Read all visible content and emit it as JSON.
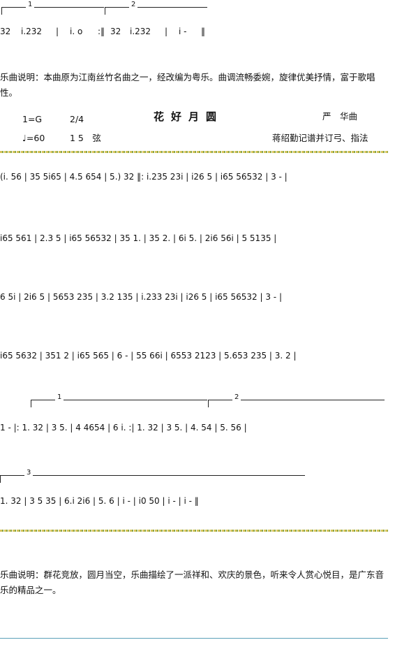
{
  "top_score": {
    "volta1": "1",
    "volta2": "2",
    "tokens": [
      "32",
      "i.232",
      "|",
      "i. o",
      ":‖",
      "32",
      "i.232",
      "|",
      "i -",
      "‖"
    ]
  },
  "intro_note": "乐曲说明：本曲原为江南丝竹名曲之一，经改编为粤乐。曲调流畅委婉，旋律优美抒情，富于歌唱性。",
  "header": {
    "key": "1=G",
    "meter": "2/4",
    "title": "花好月圆",
    "composer": "严　华曲",
    "tempo": "♩=60",
    "tuning": "1 5　弦",
    "credit": "蒋绍勤记谱并订弓、指法"
  },
  "score": {
    "line1": "(i.  56 | 35  5i65 | 4.5  654 | 5.)  32 ‖: i.235  23i | i26  5 | i65  56532 | 3 - |",
    "line2": "i65  561 | 2.3  5 | i65  56532 | 35  1. | 35  2. | 6i  5. | 2i6  56i | 5  5135 |",
    "line3": "6  5i | 2i6  5 | 5653  235 | 3.2  135 | i.233  23i | i26  5 | i65  56532 | 3 - |",
    "line4": "i65  5632 | 351  2 | i65  565 | 6 - | 55  66i | 6553  2123 | 5.653  235 | 3.  2 |",
    "line5": "1 - |: 1.  32 | 3  5. | 4  4654 | 6  i. :| 1.  32 | 3  5. | 4.  54 | 5.  56 |",
    "line6": "1.  32 | 3 5  35 | 6.i  2i6 | 5.  6 | i - | i0  50 | i - | i - ‖",
    "volta_line5_1": "1",
    "volta_line5_2": "2",
    "volta_line6_3": "3"
  },
  "ending_note": "乐曲说明：群花竞放，圆月当空，乐曲描绘了一派祥和、欢庆的景色，听来令人赏心悦目，是广东音乐的精品之一。",
  "colors": {
    "ornament_gold": "#d8c45a",
    "ornament_green": "#8aa648",
    "text": "#111111"
  }
}
